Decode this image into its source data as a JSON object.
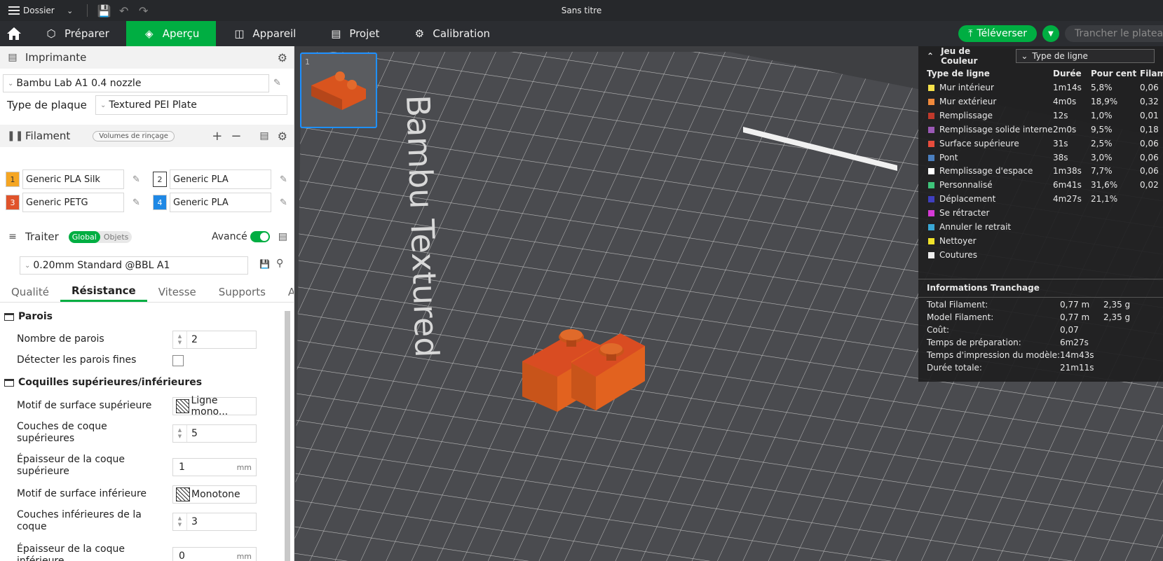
{
  "titlebar": {
    "menu_label": "Dossier",
    "title": "Sans titre"
  },
  "navbar": {
    "tabs": [
      {
        "label": "Préparer",
        "icon": "cube-icon"
      },
      {
        "label": "Aperçu",
        "icon": "layers-icon",
        "active": true
      },
      {
        "label": "Appareil",
        "icon": "device-icon"
      },
      {
        "label": "Projet",
        "icon": "project-icon"
      },
      {
        "label": "Calibration",
        "icon": "calibration-icon"
      }
    ],
    "upload_label": "Téléverser",
    "slice_label": "Trancher le plateau"
  },
  "printer": {
    "header": "Imprimante",
    "name": "Bambu Lab A1 0.4 nozzle",
    "plate_label": "Type de plaque",
    "plate_value": "Textured PEI Plate"
  },
  "filament": {
    "header": "Filament",
    "flush_label": "Volumes de rinçage",
    "items": [
      {
        "num": "1",
        "name": "Generic PLA Silk",
        "color": "#f5a623"
      },
      {
        "num": "2",
        "name": "Generic PLA",
        "color": "#ffffff"
      },
      {
        "num": "3",
        "name": "Generic PETG",
        "color": "#e0532b"
      },
      {
        "num": "4",
        "name": "Generic PLA",
        "color": "#1e88e5"
      }
    ]
  },
  "process": {
    "header": "Traiter",
    "global_label": "Global",
    "objects_label": "Objets",
    "advanced_label": "Avancé",
    "preset": "0.20mm Standard @BBL A1",
    "tabs": [
      "Qualité",
      "Résistance",
      "Vitesse",
      "Supports",
      "Autre"
    ],
    "groups": {
      "walls": "Parois",
      "shells": "Coquilles supérieures/inférieures"
    },
    "settings": {
      "wall_count_label": "Nombre de parois",
      "wall_count": "2",
      "thin_walls_label": "Détecter les parois fines",
      "top_pattern_label": "Motif de surface supérieure",
      "top_pattern": "Ligne mono...",
      "top_layers_label": "Couches de coque supérieures",
      "top_layers": "5",
      "top_thickness_label": "Épaisseur de la coque supérieure",
      "top_thickness": "1",
      "bottom_pattern_label": "Motif de surface inférieure",
      "bottom_pattern": "Monotone",
      "bottom_layers_label": "Couches inférieures de la coque",
      "bottom_layers": "3",
      "bottom_thickness_label": "Épaisseur de la coque inférieure",
      "bottom_thickness": "0",
      "unit_mm": "mm"
    }
  },
  "viewport": {
    "plate_text": "Bambu Textured",
    "thumb_num": "1"
  },
  "legend": {
    "title": "Jeu de Couleur",
    "dropdown": "Type de ligne",
    "col_type": "Type de ligne",
    "col_time": "Durée",
    "col_pct": "Pour cent",
    "col_fil": "Filam",
    "rows": [
      {
        "name": "Mur intérieur",
        "time": "1m14s",
        "pct": "5,8%",
        "fil": "0,06",
        "color": "#f5e14b"
      },
      {
        "name": "Mur extérieur",
        "time": "4m0s",
        "pct": "18,9%",
        "fil": "0,32",
        "color": "#f08a3c"
      },
      {
        "name": "Remplissage",
        "time": "12s",
        "pct": "1,0%",
        "fil": "0,01",
        "color": "#c0392b"
      },
      {
        "name": "Remplissage solide interne",
        "time": "2m0s",
        "pct": "9,5%",
        "fil": "0,18",
        "color": "#9b59b6"
      },
      {
        "name": "Surface supérieure",
        "time": "31s",
        "pct": "2,5%",
        "fil": "0,06",
        "color": "#e74c3c"
      },
      {
        "name": "Pont",
        "time": "38s",
        "pct": "3,0%",
        "fil": "0,06",
        "color": "#4a7fbf"
      },
      {
        "name": "Remplissage d'espace",
        "time": "1m38s",
        "pct": "7,7%",
        "fil": "0,06",
        "color": "#ffffff"
      },
      {
        "name": "Personnalisé",
        "time": "6m41s",
        "pct": "31,6%",
        "fil": "0,02",
        "color": "#3ec47a"
      },
      {
        "name": "Déplacement",
        "time": "4m27s",
        "pct": "21,1%",
        "fil": "",
        "color": "#3f3fbf"
      },
      {
        "name": "Se rétracter",
        "time": "",
        "pct": "",
        "fil": "",
        "color": "#d63ad6"
      },
      {
        "name": "Annuler le retrait",
        "time": "",
        "pct": "",
        "fil": "",
        "color": "#3aa8d6"
      },
      {
        "name": "Nettoyer",
        "time": "",
        "pct": "",
        "fil": "",
        "color": "#f0e22a"
      },
      {
        "name": "Coutures",
        "time": "",
        "pct": "",
        "fil": "",
        "color": "#eeeeee"
      }
    ],
    "info_title": "Informations Tranchage",
    "info": [
      {
        "key": "Total Filament:",
        "v1": "0,77 m",
        "v2": "2,35 g"
      },
      {
        "key": "Model Filament:",
        "v1": "0,77 m",
        "v2": "2,35 g"
      },
      {
        "key": "Coût:",
        "v1": "0,07",
        "v2": ""
      },
      {
        "key": "Temps de préparation:",
        "v1": "6m27s",
        "v2": ""
      },
      {
        "key": "Temps d'impression du modèle:",
        "v1": "14m43s",
        "v2": ""
      },
      {
        "key": "Durée totale:",
        "v1": "21m11s",
        "v2": ""
      }
    ]
  }
}
